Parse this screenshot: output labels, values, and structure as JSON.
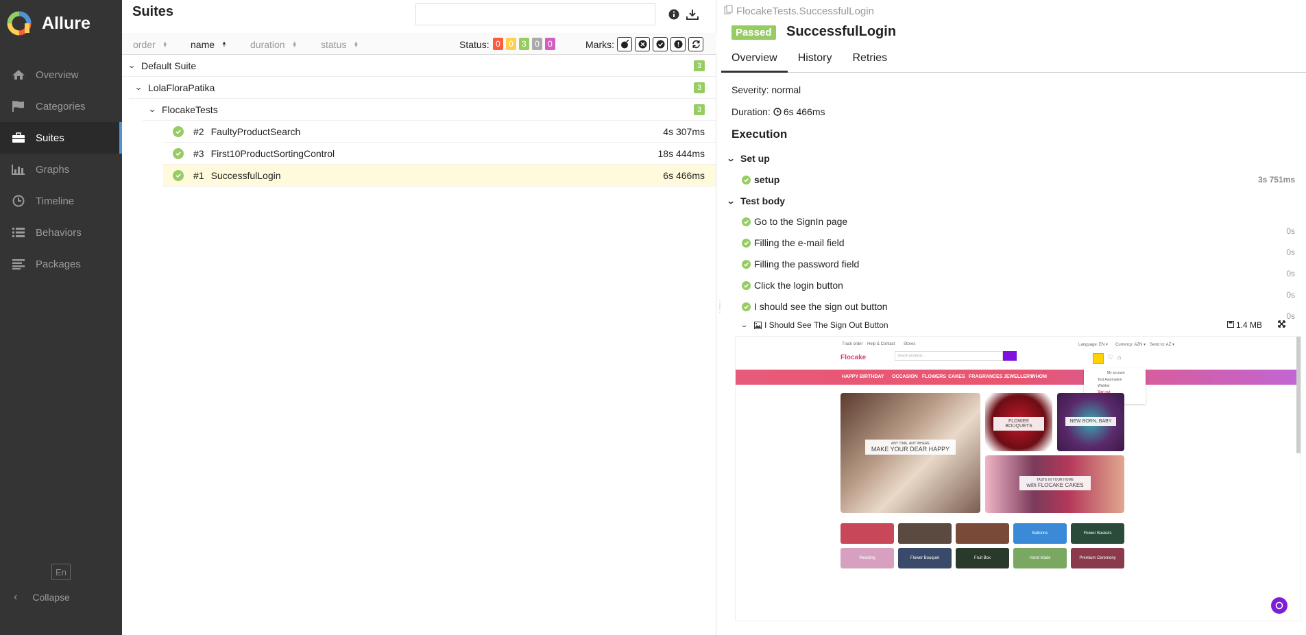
{
  "sidebar": {
    "brand": "Allure",
    "items": [
      {
        "label": "Overview",
        "icon": "home-icon"
      },
      {
        "label": "Categories",
        "icon": "flag-icon"
      },
      {
        "label": "Suites",
        "icon": "briefcase-icon"
      },
      {
        "label": "Graphs",
        "icon": "bar-chart-icon"
      },
      {
        "label": "Timeline",
        "icon": "clock-icon"
      },
      {
        "label": "Behaviors",
        "icon": "list-icon"
      },
      {
        "label": "Packages",
        "icon": "align-left-icon"
      }
    ],
    "active": "Suites",
    "lang": "En",
    "collapse": "Collapse"
  },
  "suites": {
    "title": "Suites",
    "search_value": "",
    "sorters": {
      "order": "order",
      "name": "name",
      "duration": "duration",
      "status": "status"
    },
    "status_label": "Status:",
    "status_counts": [
      {
        "value": "0",
        "color": "#fd5a3e"
      },
      {
        "value": "0",
        "color": "#ffd050"
      },
      {
        "value": "3",
        "color": "#97cc64"
      },
      {
        "value": "0",
        "color": "#aaaaaa"
      },
      {
        "value": "0",
        "color": "#d35ebe"
      }
    ],
    "marks_label": "Marks:",
    "tree": {
      "root": {
        "name": "Default Suite",
        "count": "3"
      },
      "child": {
        "name": "LolaFloraPatika",
        "count": "3"
      },
      "grandchild": {
        "name": "FlocakeTests",
        "count": "3"
      },
      "tests": [
        {
          "order": "#2",
          "name": "FaultyProductSearch",
          "duration": "4s 307ms"
        },
        {
          "order": "#3",
          "name": "First10ProductSortingControl",
          "duration": "18s 444ms"
        },
        {
          "order": "#1",
          "name": "SuccessfulLogin",
          "duration": "6s 466ms"
        }
      ]
    }
  },
  "detail": {
    "breadcrumb": "FlocakeTests.SuccessfulLogin",
    "status": "Passed",
    "title": "SuccessfulLogin",
    "tabs": [
      "Overview",
      "History",
      "Retries"
    ],
    "severity": "Severity: normal",
    "duration_label": "Duration:",
    "duration_value": "6s 466ms",
    "execution_title": "Execution",
    "setup": {
      "title": "Set up",
      "step": "setup",
      "duration": "3s 751ms"
    },
    "body": {
      "title": "Test body",
      "steps": [
        {
          "name": "Go to the SignIn page",
          "duration": "0s"
        },
        {
          "name": "Filling the e-mail field",
          "duration": "0s"
        },
        {
          "name": "Filling the password field",
          "duration": "0s"
        },
        {
          "name": "Click the login button",
          "duration": "0s"
        },
        {
          "name": "I should see the sign out button",
          "duration": "0s"
        }
      ]
    },
    "attachment": {
      "name": "I Should See The Sign Out Button",
      "size": "1.4 MB"
    }
  },
  "screenshot": {
    "top_links": [
      "Track order",
      "Help & Contact",
      "Stores"
    ],
    "top_right": [
      "Language: EN ▾",
      "Currency: AZN ▾",
      "Send to: AZ ▾"
    ],
    "logo": "Flocake",
    "search_placeholder": "Search products...",
    "menu": [
      "HAPPY BIRTHDAY",
      "OCCASION",
      "FLOWERS",
      "CAKES",
      "FRAGRANCES",
      "JEWELLERY",
      "WHOM"
    ],
    "dropdown": [
      "My account",
      "Test Automation",
      "Wishlist",
      "Sign out"
    ],
    "hero_small": "ANY TIME, ANY WHERE",
    "hero_big": "MAKE YOUR DEAR HAPPY",
    "tile1": "FLOWER BOUQUETS",
    "tile2": "NEW BORN, BABY",
    "cake_small": "TASTE IN YOUR HOME",
    "cake_big": "with FLOCAKE CAKES",
    "cats_row1": [
      "",
      "",
      "",
      "Balloons",
      "Flower Baskets"
    ],
    "cats_row2": [
      "Wedding",
      "Flower Bouquet",
      "Fruit Box",
      "Hand Made",
      "Premium Ceremony"
    ]
  }
}
